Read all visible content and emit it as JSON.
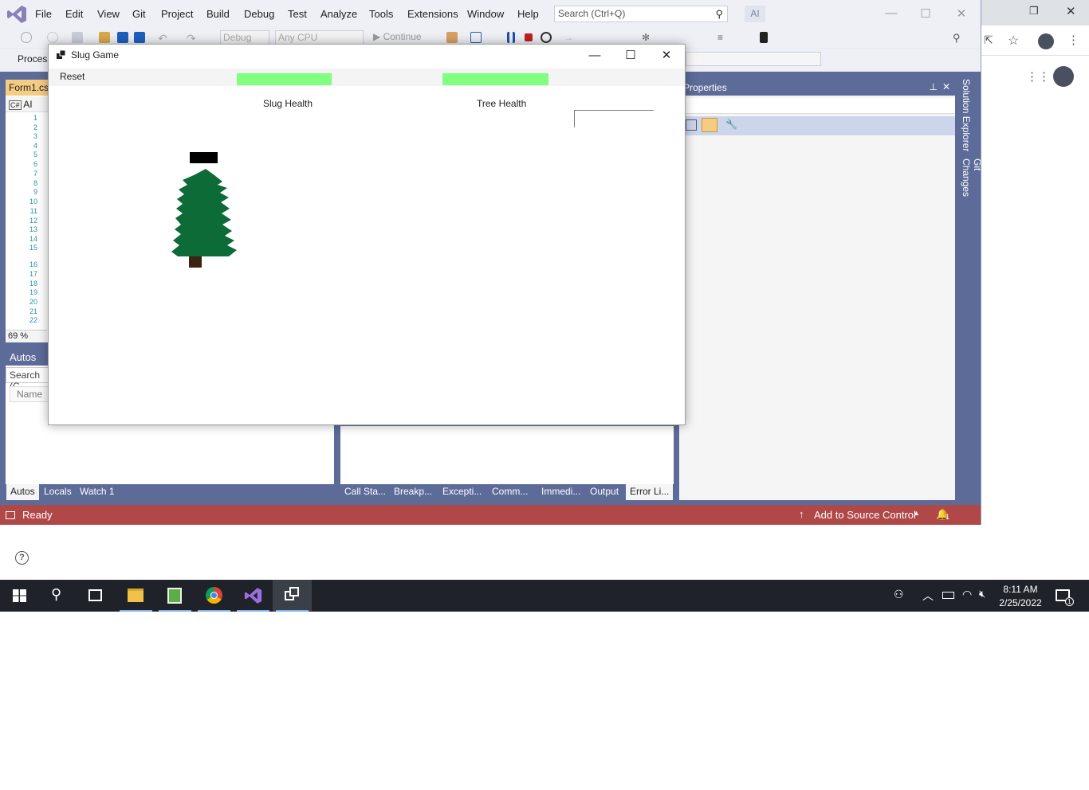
{
  "ide": {
    "menu": [
      "File",
      "Edit",
      "View",
      "Git",
      "Project",
      "Build",
      "Debug",
      "Test",
      "Analyze",
      "Tools",
      "Extensions",
      "Window",
      "Help"
    ],
    "search_placeholder": "Search (Ctrl+Q)",
    "ai_badge": "AI",
    "toolbar": {
      "config": "Debug",
      "platform": "Any CPU",
      "continue_label": "Continue"
    },
    "process_label": "Process:",
    "editor_tab": "Form1.cs",
    "editor_nav": "AI",
    "line_numbers": [
      "1",
      "2",
      "3",
      "4",
      "5",
      "6",
      "7",
      "8",
      "9",
      "10",
      "11",
      "12",
      "13",
      "14",
      "15",
      "16",
      "17",
      "18",
      "19",
      "20",
      "21",
      "22"
    ],
    "zoom": "69 %",
    "autos": {
      "title": "Autos",
      "search": "Search (C",
      "name_col": "Name"
    },
    "bottom_tabs_left": [
      "Autos",
      "Locals",
      "Watch 1"
    ],
    "bottom_tabs_right": [
      "Call Sta...",
      "Breakp...",
      "Excepti...",
      "Comm...",
      "Immedi...",
      "Output",
      "Error Li..."
    ],
    "properties_title": "Properties",
    "side_tabs": [
      "Solution Explorer",
      "Git Changes"
    ],
    "status": {
      "text": "Ready",
      "source_control": "Add to Source Control",
      "notifications": "1"
    }
  },
  "form": {
    "title": "Slug Game",
    "menu_reset": "Reset",
    "slug_health_label": "Slug Health",
    "tree_health_label": "Tree Health",
    "slug_health_fraction": 1.0,
    "tree_health_fraction": 1.0,
    "textbox_value": ""
  },
  "taskbar": {
    "time": "8:11 AM",
    "date": "2/25/2022",
    "notification_count": "1",
    "apps": [
      "start-icon",
      "search-icon",
      "task-view-icon",
      "file-explorer-icon",
      "notepad-icon",
      "chrome-icon",
      "visual-studio-icon",
      "slug-game-app-icon"
    ]
  },
  "colors": {
    "health_bar": "#80ff80",
    "tree": "#0d6b38",
    "trunk": "#3b2212",
    "vs_accent": "#5d6b99",
    "status_bar": "#b04848"
  }
}
